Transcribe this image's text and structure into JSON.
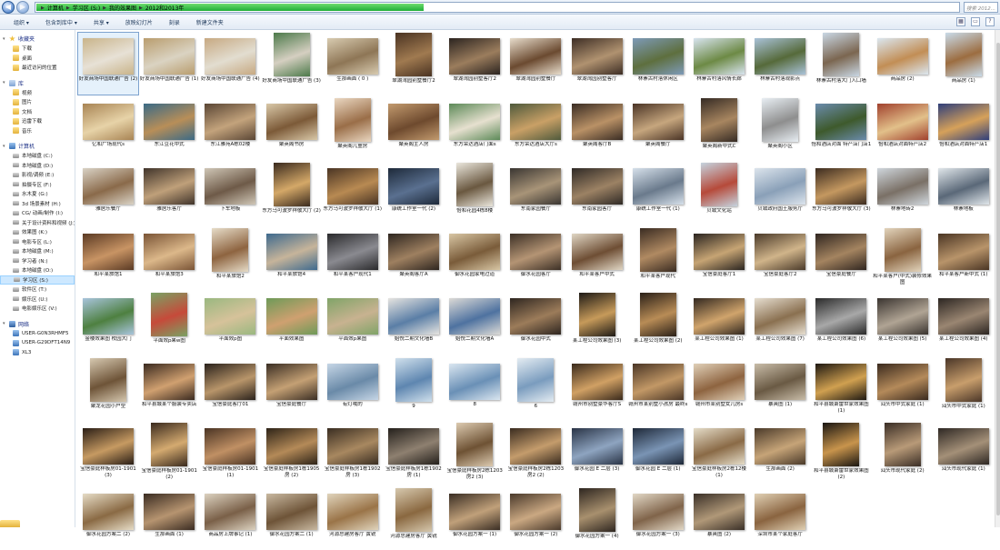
{
  "address_bar": {
    "crumbs": [
      "计算机",
      "学习区 (S:)",
      "我的效果图",
      "2012和2013年"
    ],
    "search_placeholder": "搜索 2012...",
    "progress_fraction": 0.42
  },
  "toolbar": {
    "items": [
      "组织 ▾",
      "包含到库中 ▾",
      "共享 ▾",
      "放映幻灯片",
      "刻录",
      "新建文件夹"
    ]
  },
  "nav": {
    "favorites": {
      "title": "收藏夹",
      "items": [
        "下载",
        "桌面",
        "最近访问的位置"
      ]
    },
    "libraries": {
      "title": "库",
      "items": [
        "视频",
        "图片",
        "文档",
        "迅雷下载",
        "音乐"
      ]
    },
    "computer": {
      "title": "计算机",
      "items": [
        "本地磁盘 (C:)",
        "本地磁盘 (D:)",
        "影视/调频 (E:)",
        "拍摄专区 (F:)",
        "水木夏 (G:)",
        "3d 场景素材 (H:)",
        "CG/ 动画/制作 (I:)",
        "关于设计资料和视频 (J:)",
        "效果图 (K:)",
        "电影专区 (L:)",
        "本地磁盘 (M:)",
        "学习者 (N:)",
        "本地磁盘 (O:)",
        "学习区 (S:)",
        "软件区 (T:)",
        "娱乐区 (U:)",
        "电影娱乐区 (V:)"
      ],
      "selected_index": 13
    },
    "network": {
      "title": "网络",
      "items": [
        "USER-G0N3RHMF5",
        "USER-G29DFT14N9",
        "XL3"
      ]
    }
  },
  "files": [
    {
      "name": "好友商场中国联通广告 (2)",
      "c": [
        "#c9b48a",
        "#e7e1d6"
      ]
    },
    {
      "name": "好友商场中国联通广告 (1)",
      "c": [
        "#b99d6e",
        "#dad3c2"
      ]
    },
    {
      "name": "好友商场中国联通广告 (4)",
      "c": [
        "#c7a982",
        "#e2ddd0"
      ]
    },
    {
      "name": "好友商场中国联通广告 (3)",
      "c": [
        "#4c7a4a",
        "#d5cfc1"
      ]
    },
    {
      "name": "生那画面 ( 0 )",
      "c": [
        "#d8cbb0",
        "#8e7656"
      ]
    },
    {
      "name": "翠湖湾园别墅餐厅2",
      "c": [
        "#4a3322",
        "#a07a50"
      ]
    },
    {
      "name": "翠湖湾园别墅客厅2",
      "c": [
        "#2b2420",
        "#9b7d5d"
      ]
    },
    {
      "name": "翠湖湾园别墅餐厅",
      "c": [
        "#e7dccb",
        "#6b4a30"
      ]
    },
    {
      "name": "翠湖湾园别墅客厅",
      "c": [
        "#3d2e25",
        "#b09270"
      ]
    },
    {
      "name": "林寨古村落休闲区",
      "c": [
        "#7d9ab8",
        "#5e6f3e"
      ]
    },
    {
      "name": "林寨古村落风情长廊",
      "c": [
        "#d8e4ef",
        "#6d8a45"
      ]
    },
    {
      "name": "林寨古村落观影点",
      "c": [
        "#a9c2d8",
        "#566a3a"
      ]
    },
    {
      "name": "林寨古村落大门入口墙",
      "c": [
        "#c9d7e4",
        "#7b6650"
      ]
    },
    {
      "name": "商品房 (2)",
      "c": [
        "#dbe7f0",
        "#c28e55"
      ]
    },
    {
      "name": "商品房 (1)",
      "c": [
        "#c9dbe9",
        "#9c6d40"
      ]
    },
    {
      "name": "亿和广场现代s",
      "c": [
        "#a88454",
        "#e7d3a8"
      ]
    },
    {
      "name": "东江豆花中式",
      "c": [
        "#3a6a86",
        "#b88e58"
      ]
    },
    {
      "name": "东江雅苑A栋02楼",
      "c": [
        "#5a4635",
        "#c3a37c"
      ]
    },
    {
      "name": "聚英阁书房",
      "c": [
        "#d9c8a8",
        "#7c5a38"
      ]
    },
    {
      "name": "聚英阁儿童房",
      "c": [
        "#ead7c1",
        "#9a6e48"
      ]
    },
    {
      "name": "聚英阁主人房",
      "c": [
        "#c29a6e",
        "#6e4a2e"
      ]
    },
    {
      "name": "东方荣达酒店门面s",
      "c": [
        "#5c8a58",
        "#e6e0cf"
      ]
    },
    {
      "name": "东方荣达酒店大厅s",
      "c": [
        "#4f5a3c",
        "#c9a066"
      ]
    },
    {
      "name": "聚英阁客厅B",
      "c": [
        "#3a2d24",
        "#b99166"
      ]
    },
    {
      "name": "聚英阁餐厅",
      "c": [
        "#4a3426",
        "#c6a67e"
      ]
    },
    {
      "name": "聚英阁新中式C",
      "c": [
        "#352b24",
        "#a88660"
      ]
    },
    {
      "name": "聚英阁小区",
      "c": [
        "#e8eef3",
        "#8e8e8e"
      ]
    },
    {
      "name": "怡和酒店对面 特产店门店1",
      "c": [
        "#6a8bac",
        "#3e5a2c"
      ]
    },
    {
      "name": "怡和酒店对面特产店2",
      "c": [
        "#a1412e",
        "#e2c08a"
      ]
    },
    {
      "name": "怡和酒店对面特产店1",
      "c": [
        "#2f3f7a",
        "#d6a15a"
      ]
    },
    {
      "name": "雅居乐餐厅",
      "c": [
        "#d9d2c5",
        "#8a6a4a"
      ]
    },
    {
      "name": "雅居乐客厅",
      "c": [
        "#40342b",
        "#bfa07a"
      ]
    },
    {
      "name": "下车地板",
      "c": [
        "#cfc6b6",
        "#6e5a48"
      ]
    },
    {
      "name": "东方马可波罗祥敬大厅 (2)",
      "c": [
        "#3a2a1e",
        "#d4a868"
      ]
    },
    {
      "name": "东方马可波罗祥敬大厅 (1)",
      "c": [
        "#4a3524",
        "#b88a52"
      ]
    },
    {
      "name": "康统工作室一代 (2)",
      "c": [
        "#1e2a3a",
        "#5a7090"
      ]
    },
    {
      "name": "怡和花园4栋8楼",
      "c": [
        "#eae6dc",
        "#6a5840"
      ]
    },
    {
      "name": "东南家园餐厅",
      "c": [
        "#3a3632",
        "#a89478"
      ]
    },
    {
      "name": "东南家园客厅",
      "c": [
        "#2f2a26",
        "#9c8264"
      ]
    },
    {
      "name": "康统工作室一代 (1)",
      "c": [
        "#d6e0ea",
        "#6a7a8c"
      ]
    },
    {
      "name": "贝致文化站",
      "c": [
        "#c5d3de",
        "#b64a3a"
      ]
    },
    {
      "name": "贝致政府国土服务厅",
      "c": [
        "#dce4ec",
        "#8aa0b8"
      ]
    },
    {
      "name": "东方马可波罗祥敬大厅 (3)",
      "c": [
        "#3c2c20",
        "#c49860"
      ]
    },
    {
      "name": "林寨地砖2",
      "c": [
        "#cfd6dc",
        "#7a7066"
      ]
    },
    {
      "name": "林寨地板",
      "c": [
        "#e0e6ea",
        "#5a6878"
      ]
    },
    {
      "name": "和平某旅馆1",
      "c": [
        "#5a3a24",
        "#c89464"
      ]
    },
    {
      "name": "和平某旅馆3",
      "c": [
        "#7a5436",
        "#dcb88a"
      ]
    },
    {
      "name": "和平某旅馆2",
      "c": [
        "#e6dcc8",
        "#8e6440"
      ]
    },
    {
      "name": "和平某旅馆4",
      "c": [
        "#3e6a8e",
        "#c6b49a"
      ]
    },
    {
      "name": "和平某客户现代1",
      "c": [
        "#2a2a2c",
        "#8a8a90"
      ]
    },
    {
      "name": "聚英阁客厅A",
      "c": [
        "#2e2620",
        "#9e8060"
      ]
    },
    {
      "name": "御水花园家电过道",
      "c": [
        "#d8c6a4",
        "#7a5c3a"
      ]
    },
    {
      "name": "御水花园客厅",
      "c": [
        "#3c3026",
        "#b49474"
      ]
    },
    {
      "name": "和平某客户中式",
      "c": [
        "#e0d6c4",
        "#6e4e34"
      ]
    },
    {
      "name": "和平某客户现代",
      "c": [
        "#3a2c22",
        "#b08a62"
      ]
    },
    {
      "name": "宝信豪庭客厅1",
      "c": [
        "#2a2420",
        "#c6a474"
      ]
    },
    {
      "name": "宝信豪庭客厅2",
      "c": [
        "#4a3a2a",
        "#d0b48a"
      ]
    },
    {
      "name": "宝信豪庭餐厅",
      "c": [
        "#302620",
        "#a48460"
      ]
    },
    {
      "name": "和平某客户(中式)装修效果图",
      "c": [
        "#e2d4bc",
        "#8a6440"
      ]
    },
    {
      "name": "和平某客户新中式 (1)",
      "c": [
        "#4a3524",
        "#b8946a"
      ]
    },
    {
      "name": "金楼效果图 校园大门",
      "c": [
        "#a8c4dc",
        "#4e8040"
      ]
    },
    {
      "name": "平面效p果w图",
      "c": [
        "#7aa264",
        "#c64a3a"
      ]
    },
    {
      "name": "平面效p图",
      "c": [
        "#9ab880",
        "#d6c29a"
      ]
    },
    {
      "name": "平面效果图",
      "c": [
        "#6e9a58",
        "#cfa070"
      ]
    },
    {
      "name": "平面效p果图",
      "c": [
        "#80a468",
        "#c8b290"
      ]
    },
    {
      "name": "始悦二期文化墙B",
      "c": [
        "#e6e4e0",
        "#5a7ea6"
      ]
    },
    {
      "name": "始悦二期文化墙A",
      "c": [
        "#dcdad6",
        "#4e72a0"
      ]
    },
    {
      "name": "御水花园中式",
      "c": [
        "#2e2620",
        "#9c7c5a"
      ]
    },
    {
      "name": "某工程公司效果图 (3)",
      "c": [
        "#1e1a16",
        "#c69a5a"
      ]
    },
    {
      "name": "某工程公司效果图 (2)",
      "c": [
        "#2a2018",
        "#b88c56"
      ]
    },
    {
      "name": "某工程公司效果图 (1)",
      "c": [
        "#322820",
        "#d0a46c"
      ]
    },
    {
      "name": "某工程公司效果图 (7)",
      "c": [
        "#e6ded0",
        "#8a7050"
      ]
    },
    {
      "name": "某工程公司效果图 (6)",
      "c": [
        "#2a2a2a",
        "#a8a8a8"
      ]
    },
    {
      "name": "某工程公司效果图 (5)",
      "c": [
        "#3a3430",
        "#b0a494"
      ]
    },
    {
      "name": "某工程公司效果图 (4)",
      "c": [
        "#2c2622",
        "#9a8672"
      ]
    },
    {
      "name": "聚龙花园小户型",
      "c": [
        "#d6c8b0",
        "#6e5438"
      ]
    },
    {
      "name": "和平县城某个服装专卖店",
      "c": [
        "#3a2a20",
        "#d0a070"
      ]
    },
    {
      "name": "宝信豪庭客厅01",
      "c": [
        "#2a221c",
        "#b8956a"
      ]
    },
    {
      "name": "宝信豪庭餐厅",
      "c": [
        "#3a2e24",
        "#c4a074"
      ]
    },
    {
      "name": "有灯哦的",
      "c": [
        "#c6d6e6",
        "#6a8aa8"
      ]
    },
    {
      "name": "9",
      "c": [
        "#d0e0ec",
        "#5e86b0"
      ]
    },
    {
      "name": "8",
      "c": [
        "#dae6f0",
        "#6a90b6"
      ]
    },
    {
      "name": "6",
      "c": [
        "#e4ecf2",
        "#7a9cbe"
      ]
    },
    {
      "name": "赣州市别墅豪华客厅S",
      "c": [
        "#3a2a1c",
        "#d0a064"
      ]
    },
    {
      "name": "赣州市某别墅小孩房 最终s",
      "c": [
        "#4a3626",
        "#c29866"
      ]
    },
    {
      "name": "赣州市某别墅女儿房s",
      "c": [
        "#e0d0b8",
        "#8e6440"
      ]
    },
    {
      "name": "暴爽图 (1)",
      "c": [
        "#c8bca8",
        "#6a5a44"
      ]
    },
    {
      "name": "和平县城萧雷世家效果图 (1)",
      "c": [
        "#1e1812",
        "#d0a050"
      ]
    },
    {
      "name": "汕头市中式家庭 (1)",
      "c": [
        "#3a2a1e",
        "#b48a5a"
      ]
    },
    {
      "name": "汕头市中式家庭 (1)",
      "c": [
        "#4a3628",
        "#c89e6c"
      ]
    },
    {
      "name": "宝信豪庭样板房01-1901 (3)",
      "c": [
        "#2a1e16",
        "#c69a62"
      ]
    },
    {
      "name": "宝信豪庭样板房01-1901 (2)",
      "c": [
        "#3a2a1e",
        "#d4aa70"
      ]
    },
    {
      "name": "宝信豪庭样板房01-1901 (1)",
      "c": [
        "#4a3424",
        "#c09064"
      ]
    },
    {
      "name": "宝信豪庭样板房1栋1905房 (2)",
      "c": [
        "#2e2418",
        "#b48a58"
      ]
    },
    {
      "name": "宝信豪庭样板房1栋1902房 (3)",
      "c": [
        "#3a2e22",
        "#a88860"
      ]
    },
    {
      "name": "宝信豪庭样板房1栋1902房 (1)",
      "c": [
        "#24201c",
        "#8e8070"
      ]
    },
    {
      "name": "宝信豪庭样板房2栋1203房2 (3)",
      "c": [
        "#dccab0",
        "#6e5234"
      ]
    },
    {
      "name": "宝信豪庭样板房2栋1203房2 (2)",
      "c": [
        "#3a2c20",
        "#c49c6c"
      ]
    },
    {
      "name": "御水花园 E 二层 (3)",
      "c": [
        "#2a3446",
        "#8ea4c0"
      ]
    },
    {
      "name": "御水花园 E 二层 (1)",
      "c": [
        "#1e2838",
        "#7a94b4"
      ]
    },
    {
      "name": "宝信豪庭样板房2栋12楼 (1)",
      "c": [
        "#e4dcc8",
        "#8a6a46"
      ]
    },
    {
      "name": "生那画面 (2)",
      "c": [
        "#4a3a2a",
        "#c6a478"
      ]
    },
    {
      "name": "和平县城萧雷世家效果图 (2)",
      "c": [
        "#1a1612",
        "#c8944c"
      ]
    },
    {
      "name": "汕头市现代家庭 (2)",
      "c": [
        "#3a2e26",
        "#b89a78"
      ]
    },
    {
      "name": "汕头市现代家庭 (1)",
      "c": [
        "#2e2824",
        "#a49078"
      ]
    },
    {
      "name": "御水花园方案二 (2)",
      "c": [
        "#e6dcc6",
        "#8a6a44"
      ]
    },
    {
      "name": "生那画面 (1)",
      "c": [
        "#3a2c22",
        "#b69470"
      ]
    },
    {
      "name": "商品房上牌事记 (1)",
      "c": [
        "#dcd2c0",
        "#7a6048"
      ]
    },
    {
      "name": "御水花园方案二 (1)",
      "c": [
        "#c8b8a0",
        "#6e5438"
      ]
    },
    {
      "name": "河源总建房客厅 黄锐",
      "c": [
        "#e0d4bc",
        "#9a7448"
      ]
    },
    {
      "name": "河源总建房客厅 黄锐",
      "c": [
        "#d6c8ae",
        "#8a6840"
      ]
    },
    {
      "name": "御水花园方案一 (1)",
      "c": [
        "#3a2e24",
        "#c0a07a"
      ]
    },
    {
      "name": "御水花园方案一 (2)",
      "c": [
        "#4a3a2c",
        "#caa882"
      ]
    },
    {
      "name": "御水花园方案一 (4)",
      "c": [
        "#2e2620",
        "#a8906e"
      ]
    },
    {
      "name": "御水花园方案一 (3)",
      "c": [
        "#e2d8c6",
        "#80644a"
      ]
    },
    {
      "name": "暴爽图 (2)",
      "c": [
        "#3a3028",
        "#b09878"
      ]
    },
    {
      "name": "深圳市某个家庭客厅",
      "c": [
        "#e0d0b4",
        "#8a6440"
      ]
    }
  ],
  "colors": {
    "accent": "#cde8ff",
    "progress": "#1fae36"
  }
}
